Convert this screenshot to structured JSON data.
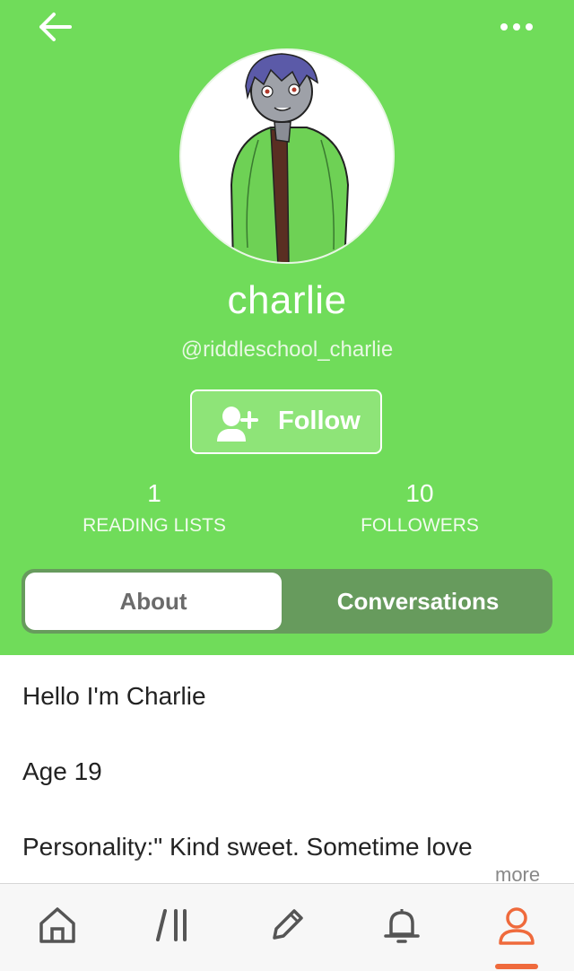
{
  "colors": {
    "header_bg": "#70dc5a",
    "segment_bg": "#679b5d",
    "active_tab": "#ef6a3c",
    "tab_icon": "#555555"
  },
  "nav": {
    "back_icon": "arrow-left-icon",
    "more_icon": "more-horizontal-icon"
  },
  "profile": {
    "display_name": "charlie",
    "username": "@riddleschool_charlie",
    "follow_label": "Follow",
    "follow_icon": "add-user-icon"
  },
  "stats": [
    {
      "count": "1",
      "label": "READING LISTS"
    },
    {
      "count": "10",
      "label": "FOLLOWERS"
    }
  ],
  "segments": {
    "about": "About",
    "conversations": "Conversations",
    "selected": "About"
  },
  "about": {
    "lines": [
      "Hello I'm Charlie",
      "Age 19",
      "Personality:\" Kind sweet. Sometime love"
    ],
    "more": "more"
  },
  "tabbar": [
    {
      "icon": "home-icon",
      "active": false
    },
    {
      "icon": "library-icon",
      "active": false
    },
    {
      "icon": "pencil-icon",
      "active": false
    },
    {
      "icon": "bell-icon",
      "active": false
    },
    {
      "icon": "profile-icon",
      "active": true
    }
  ]
}
